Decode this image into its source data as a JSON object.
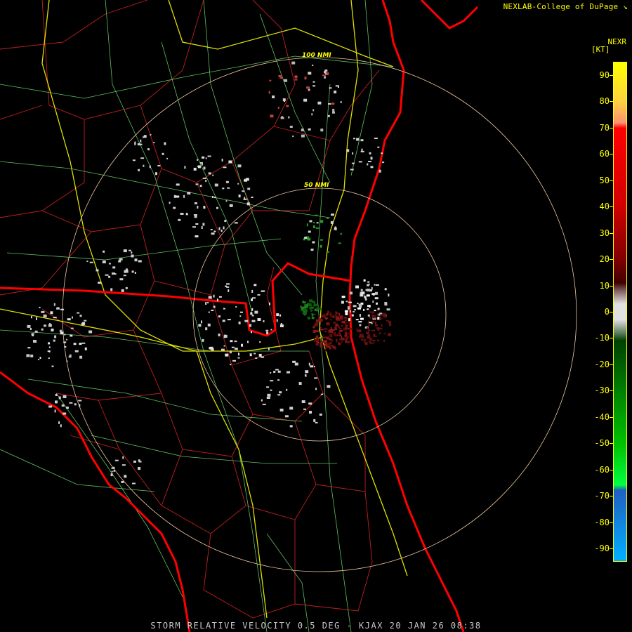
{
  "header": {
    "credit": "NEXLAB-College of DuPage",
    "credit_icon": "diagonal-arrow-icon",
    "product": "NEXR",
    "units": "[KT]"
  },
  "range_rings": {
    "labels": [
      "100 NMI",
      "50 NMI"
    ],
    "color": "#f0c8a0"
  },
  "colorbar": {
    "ticks": [
      "90",
      "80",
      "70",
      "60",
      "50",
      "40",
      "30",
      "20",
      "10",
      "0",
      "-10",
      "-20",
      "-30",
      "-40",
      "-50",
      "-60",
      "-70",
      "-80",
      "-90"
    ],
    "min": -95,
    "max": 95,
    "stops": [
      {
        "v": 95,
        "c": "#ffff00"
      },
      {
        "v": 80,
        "c": "#ffd040"
      },
      {
        "v": 72,
        "c": "#ff9070"
      },
      {
        "v": 70,
        "c": "#ff0000"
      },
      {
        "v": 40,
        "c": "#d00000"
      },
      {
        "v": 20,
        "c": "#800000"
      },
      {
        "v": 11,
        "c": "#400000"
      },
      {
        "v": 8,
        "c": "#806060"
      },
      {
        "v": 3,
        "c": "#e0e0e0"
      },
      {
        "v": -3,
        "c": "#e0e0e0"
      },
      {
        "v": -8,
        "c": "#608060"
      },
      {
        "v": -11,
        "c": "#004000"
      },
      {
        "v": -30,
        "c": "#008000"
      },
      {
        "v": -50,
        "c": "#00c000"
      },
      {
        "v": -66,
        "c": "#00ff40"
      },
      {
        "v": -68,
        "c": "#2060c0"
      },
      {
        "v": -95,
        "c": "#00b0ff"
      }
    ]
  },
  "map_colors": {
    "background": "#000000",
    "county_lines": "#c02020",
    "state_line_and_coast": "#ff0000",
    "highways": "#ffff00",
    "roads": "#60c060"
  },
  "bottom": {
    "caption": "STORM RELATIVE VELOCITY 0.5 DEG - KJAX 20 JAN 26 08:38"
  }
}
